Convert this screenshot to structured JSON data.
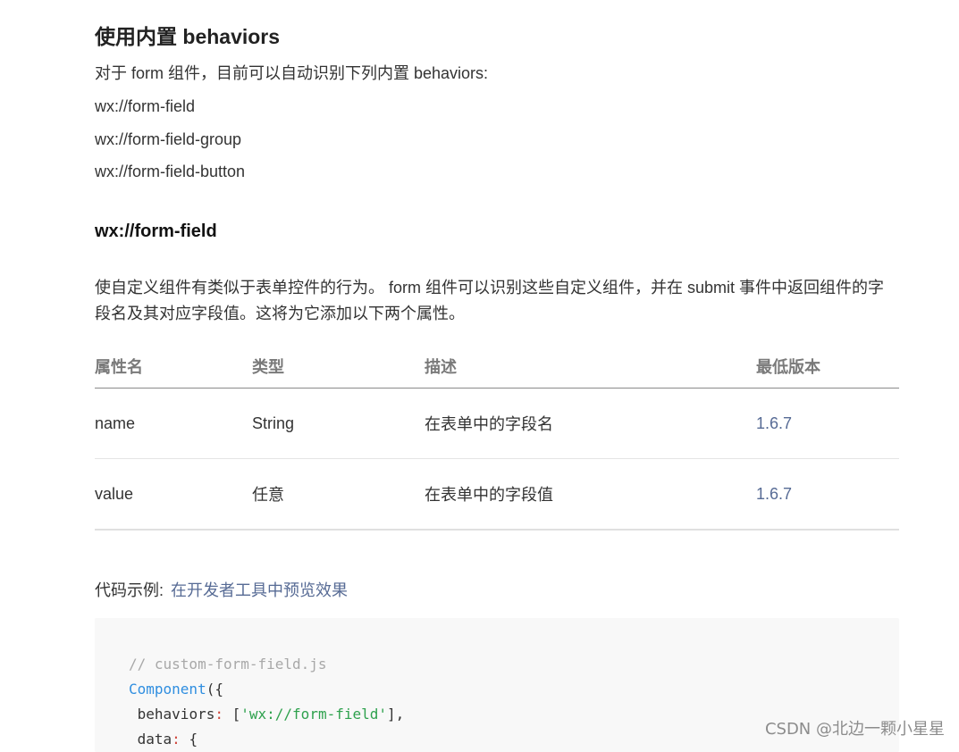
{
  "section": {
    "title": "使用内置 behaviors",
    "intro": "对于 form 组件，目前可以自动识别下列内置 behaviors:",
    "behaviors": [
      "wx://form-field",
      "wx://form-field-group",
      "wx://form-field-button"
    ]
  },
  "subsection": {
    "title": "wx://form-field",
    "description": "使自定义组件有类似于表单控件的行为。 form 组件可以识别这些自定义组件，并在 submit 事件中返回组件的字段名及其对应字段值。这将为它添加以下两个属性。"
  },
  "table": {
    "headers": [
      "属性名",
      "类型",
      "描述",
      "最低版本"
    ],
    "rows": [
      [
        "name",
        "String",
        "在表单中的字段名",
        "1.6.7"
      ],
      [
        "value",
        "任意",
        "在表单中的字段值",
        "1.6.7"
      ]
    ]
  },
  "example": {
    "label": "代码示例:",
    "link_text": "在开发者工具中预览效果"
  },
  "code": {
    "comment": "// custom-form-field.js",
    "fn": "Component",
    "open": "({",
    "key_behaviors": "behaviors",
    "colon": ":",
    "bracket_open": " [",
    "str_value": "'wx://form-field'",
    "bracket_close": "],",
    "key_data": "data",
    "brace_open": " {"
  },
  "watermark": "CSDN @北边一颗小星星",
  "colors": {
    "link": "#576b95",
    "code_fn": "#2f8ee0",
    "code_string": "#2ea14d",
    "code_comment": "#a8a8a8"
  }
}
